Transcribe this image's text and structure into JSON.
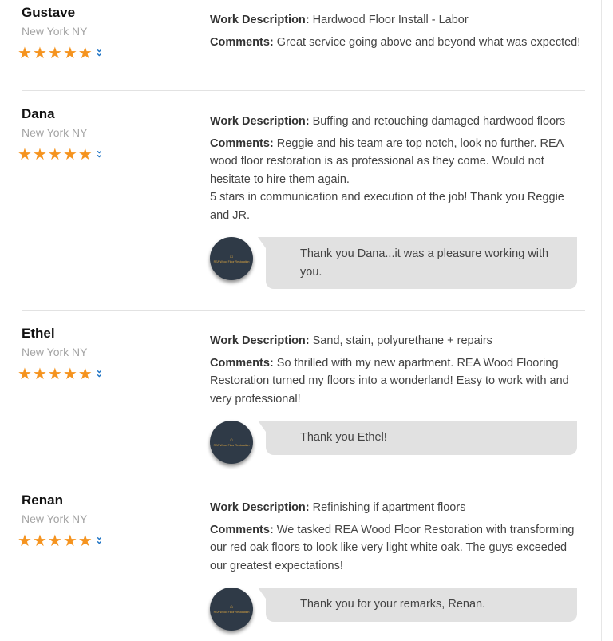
{
  "reviews": [
    {
      "name": "Gustave",
      "location": "New York NY",
      "rating": 5,
      "work_label": "Work Description:",
      "work": "Hardwood Floor Install - Labor",
      "comments_label": "Comments:",
      "comments": "Great service going above and beyond what was expected!",
      "comments_extra": "",
      "reply": ""
    },
    {
      "name": "Dana",
      "location": "New York NY",
      "rating": 5,
      "work_label": "Work Description:",
      "work": "Buffing and retouching damaged hardwood floors",
      "comments_label": "Comments:",
      "comments": "Reggie and his team are top notch, look no further. REA wood floor restoration is as professional as they come. Would not hesitate to hire them again.",
      "comments_extra": "5 stars in communication and execution of the job! Thank you Reggie and JR.",
      "reply": "Thank you Dana...it was a pleasure working with you."
    },
    {
      "name": "Ethel",
      "location": "New York NY",
      "rating": 5,
      "work_label": "Work Description:",
      "work": "Sand, stain, polyurethane + repairs",
      "comments_label": "Comments:",
      "comments": "So thrilled with my new apartment. REA Wood Flooring Restoration turned my floors into a wonderland! Easy to work with and very professional!",
      "comments_extra": "",
      "reply": "Thank you Ethel!"
    },
    {
      "name": "Renan",
      "location": "New York NY",
      "rating": 5,
      "work_label": "Work Description:",
      "work": "Refinishing if apartment floors",
      "comments_label": "Comments:",
      "comments": "We tasked REA Wood Floor Restoration with transforming our red oak floors to look like very light white oak. The guys exceeded our greatest expectations!",
      "comments_extra": "",
      "reply": "Thank you for your remarks, Renan."
    }
  ],
  "logo_text": "REA Wood Floor Restoration",
  "colors": {
    "star": "#f5931e",
    "expand": "#1f74c4",
    "bubble": "#e1e1e1",
    "logo_bg": "#2f3a47"
  },
  "icons": {
    "star": "star-icon",
    "expand": "double-chevron-down-icon",
    "logo": "company-logo"
  }
}
